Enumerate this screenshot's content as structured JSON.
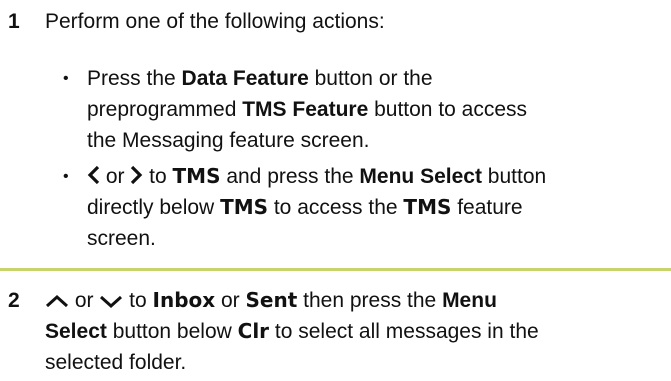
{
  "step1": {
    "number": "1",
    "intro": "Perform one of the following actions:",
    "bullet_a": {
      "marker": "•",
      "t1": "Press the ",
      "b1": "Data Feature",
      "t2": " button or the",
      "t3": "preprogrammed ",
      "b2": "TMS Feature",
      "t4": " button to access",
      "t5": "the Messaging feature screen."
    },
    "bullet_b": {
      "marker": "•",
      "icon_left": "chevron-left-icon",
      "or1": " or ",
      "icon_right": "chevron-right-icon",
      "to1": " to ",
      "d1": "TMS",
      "t1": " and press the ",
      "b1": "Menu Select",
      "t2": " button",
      "t3": "directly below ",
      "d2": "TMS",
      "t4": " to access the ",
      "d3": "TMS",
      "t5": " feature",
      "t6": "screen."
    }
  },
  "step2": {
    "number": "2",
    "icon_up": "chevron-up-icon",
    "or1": " or ",
    "icon_down": "chevron-down-icon",
    "to1": " to ",
    "d1": "Inbox",
    "or2": " or ",
    "d2": "Sent",
    "t1": " then press the ",
    "b1": "Menu",
    "b2": "Select",
    "t2": " button below ",
    "d3": "Clr",
    "t3": " to select all messages in the",
    "t4": "selected folder."
  },
  "colors": {
    "divider": "#c7d36b",
    "text": "#111111"
  }
}
